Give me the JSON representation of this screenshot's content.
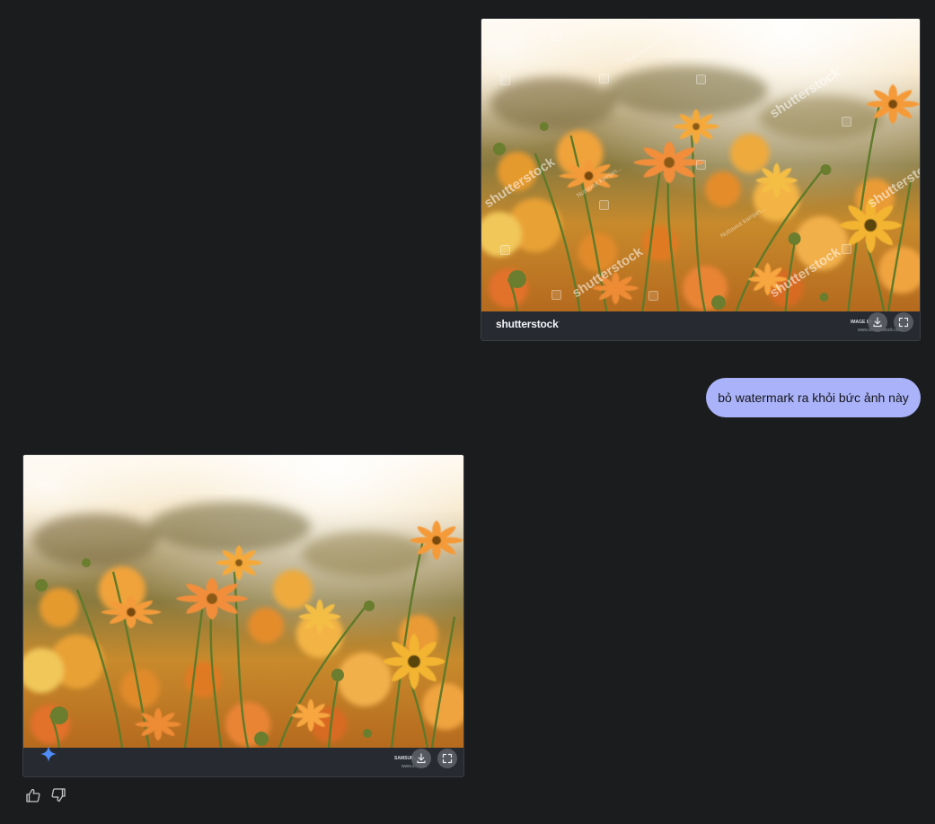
{
  "user_message": {
    "text": "bỏ watermark ra khỏi bức ảnh này"
  },
  "uploaded_image": {
    "brand": "shutterstock",
    "brand_mark": "·",
    "footer_line1": "IMAGE ID: ...",
    "footer_line2": "www.shutterstock.com",
    "watermark_text": "shutterstock",
    "watermark_credit": "Nuttawut kamjan...",
    "download_icon": "download-icon",
    "expand_icon": "expand-icon"
  },
  "generated_image": {
    "footer_line1": "SAMSUN...",
    "footer_line2": "www.s...com",
    "sparkle_icon": "sparkle-icon",
    "download_icon": "download-icon",
    "expand_icon": "expand-icon"
  },
  "feedback": {
    "like_icon": "thumbs-up-icon",
    "dislike_icon": "thumbs-down-icon"
  },
  "colors": {
    "background": "#1b1c1e",
    "bubble": "#aab3f9",
    "sparkle": "#4e8cf7",
    "card_footer": "#272a31"
  }
}
